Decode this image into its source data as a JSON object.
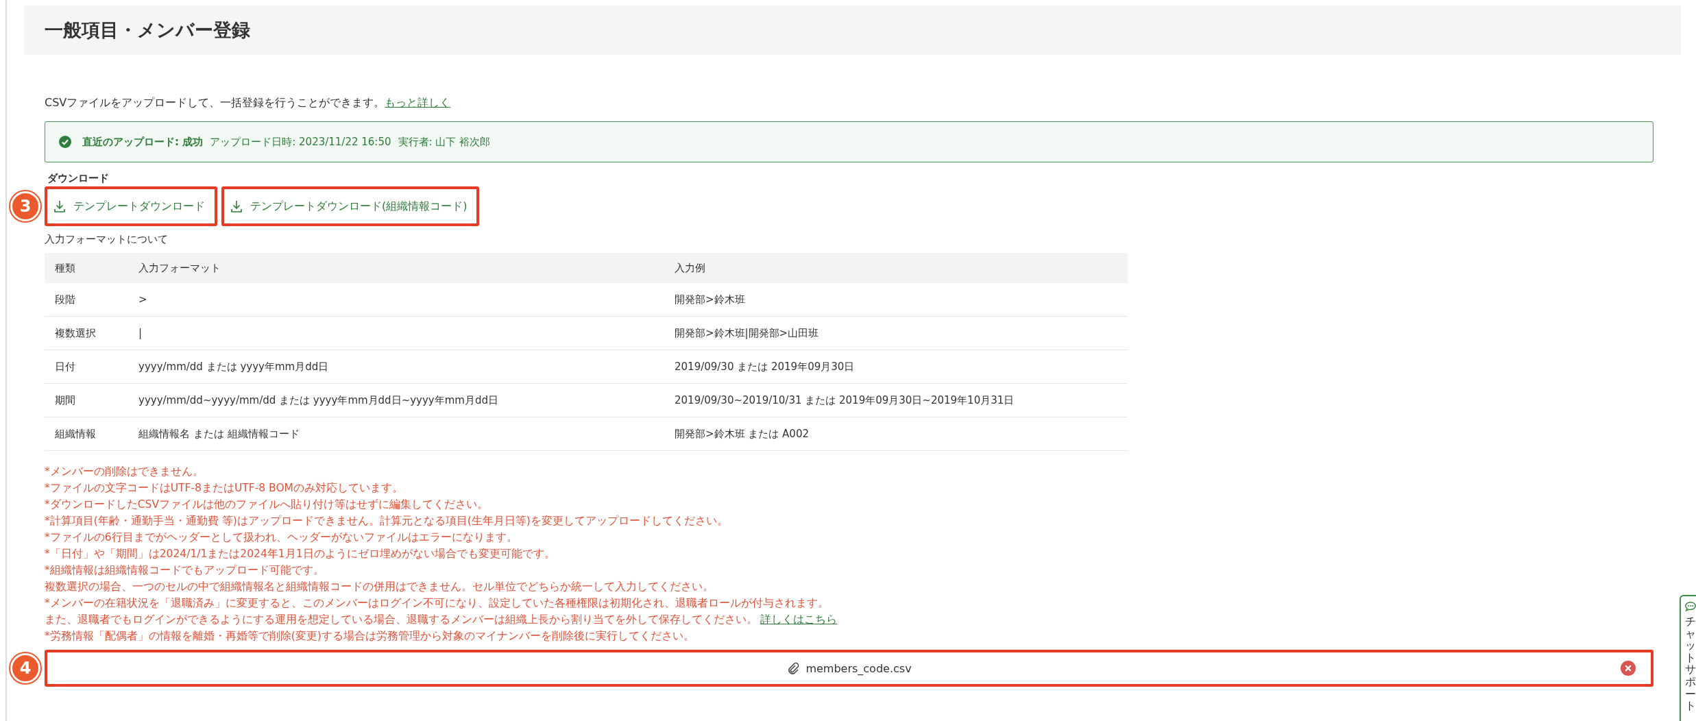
{
  "page": {
    "title": "一般項目・メンバー登録"
  },
  "intro": {
    "text": "CSVファイルをアップロードして、一括登録を行うことができます。",
    "link": "もっと詳しく"
  },
  "status": {
    "label": "直近のアップロード: 成功",
    "date": "アップロード日時: 2023/11/22 16:50",
    "user": "実行者: 山下 裕次郎"
  },
  "download": {
    "heading": "ダウンロード",
    "annotation": "3",
    "buttons": [
      "テンプレートダウンロード",
      "テンプレートダウンロード(組織情報コード)"
    ]
  },
  "format": {
    "title": "入力フォーマットについて",
    "columns": [
      "種類",
      "入力フォーマット",
      "入力例"
    ],
    "rows": [
      [
        "段階",
        ">",
        "開発部>鈴木班"
      ],
      [
        "複数選択",
        "|",
        "開発部>鈴木班|開発部>山田班"
      ],
      [
        "日付",
        "yyyy/mm/dd または yyyy年mm月dd日",
        "2019/09/30 または 2019年09月30日"
      ],
      [
        "期間",
        "yyyy/mm/dd~yyyy/mm/dd または yyyy年mm月dd日~yyyy年mm月dd日",
        "2019/09/30~2019/10/31 または 2019年09月30日~2019年10月31日"
      ],
      [
        "組織情報",
        "組織情報名 または 組織情報コード",
        "開発部>鈴木班 または A002"
      ]
    ]
  },
  "notes": [
    {
      "text": "*メンバーの削除はできません。"
    },
    {
      "text": "*ファイルの文字コードはUTF-8またはUTF-8 BOMのみ対応しています。"
    },
    {
      "text": "*ダウンロードしたCSVファイルは他のファイルへ貼り付け等はせずに編集してください。"
    },
    {
      "text": "*計算項目(年齢・通勤手当・通勤費 等)はアップロードできません。計算元となる項目(生年月日等)を変更してアップロードしてください。"
    },
    {
      "text": "*ファイルの6行目までがヘッダーとして扱われ、ヘッダーがないファイルはエラーになります。"
    },
    {
      "text": "*「日付」や「期間」は2024/1/1または2024年1月1日のようにゼロ埋めがない場合でも変更可能です。"
    },
    {
      "text": "*組織情報は組織情報コードでもアップロード可能です。"
    },
    {
      "text": "複数選択の場合、一つのセルの中で組織情報名と組織情報コードの併用はできません。セル単位でどちらか統一して入力してください。"
    },
    {
      "text": "*メンバーの在籍状況を「退職済み」に変更すると、このメンバーはログイン不可になり、設定していた各種権限は初期化され、退職者ロールが付与されます。"
    },
    {
      "text": "また、退職者でもログインができるようにする運用を想定している場合、退職するメンバーは組織上長から割り当てを外して保存してください。",
      "link": "詳しくはこちら"
    },
    {
      "text": "*労務情報「配偶者」の情報を離婚・再婚等で削除(変更)する場合は労務管理から対象のマイナンバーを削除後に実行してください。"
    }
  ],
  "file": {
    "name": "members_code.csv",
    "annotation": "4"
  },
  "chat": {
    "label": "チャットサポート"
  }
}
